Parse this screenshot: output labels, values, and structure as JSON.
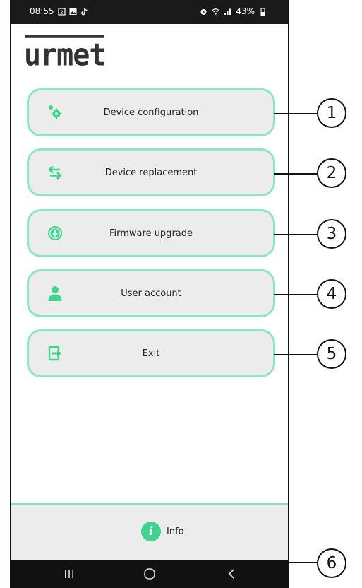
{
  "status_bar": {
    "time": "08:55",
    "left_icons": [
      "sim-icon",
      "gallery-icon",
      "tiktok-icon"
    ],
    "right_icons": [
      "alarm-icon",
      "wifi-icon",
      "signal-icon",
      "battery-icon"
    ],
    "battery": "43%"
  },
  "app": {
    "logo_text": "urmet",
    "accent_color": "#8ee5c2",
    "icon_color": "#3ed38e"
  },
  "menu": {
    "items": [
      {
        "label": "Device configuration",
        "icon": "gear-icon"
      },
      {
        "label": "Device replacement",
        "icon": "swap-arrows-icon"
      },
      {
        "label": "Firmware upgrade",
        "icon": "download-icon"
      },
      {
        "label": "User account",
        "icon": "user-icon"
      },
      {
        "label": "Exit",
        "icon": "exit-icon"
      }
    ]
  },
  "footer": {
    "info_icon_text": "i",
    "info_label": "Info"
  },
  "navigation_bar": {
    "buttons": [
      "recent-apps-icon",
      "home-icon",
      "back-icon"
    ]
  },
  "callouts": [
    "1",
    "2",
    "3",
    "4",
    "5",
    "6"
  ]
}
